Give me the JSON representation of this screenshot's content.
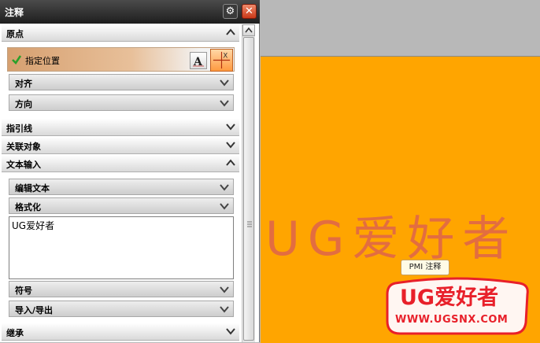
{
  "dialog": {
    "title": "注释",
    "sections": {
      "origin": "原点",
      "leader": "指引线",
      "associated": "关联对象",
      "text_input": "文本输入",
      "inherit": "继承"
    },
    "origin": {
      "specify_location": "指定位置",
      "align": "对齐",
      "orientation": "方向"
    },
    "text_input": {
      "edit_text": "编辑文本",
      "formatting": "格式化",
      "text_value": "UG爱好者",
      "symbols": "符号",
      "import_export": "导入/导出"
    }
  },
  "viewport": {
    "annotation_text": "UG爱好者",
    "tooltip": "PMI 注释"
  },
  "watermark": {
    "name": "UG爱好者",
    "url": "WWW.UGSNX.COM"
  }
}
